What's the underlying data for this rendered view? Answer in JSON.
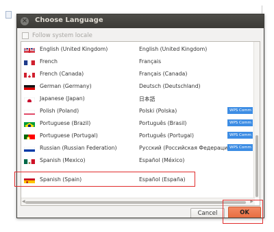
{
  "dialog": {
    "title": "Choose Language",
    "close_glyph": "×",
    "follow_label": "Follow system locale",
    "follow_checked": false
  },
  "languages": [
    {
      "english": "English (United Kingdom)",
      "native": "English (United Kingdom)",
      "flag": "uk-flag-icon",
      "badge": ""
    },
    {
      "english": "French",
      "native": "Français",
      "flag": "france-flag-icon",
      "badge": ""
    },
    {
      "english": "French (Canada)",
      "native": "Français (Canada)",
      "flag": "canada-flag-icon",
      "badge": ""
    },
    {
      "english": "German (Germany)",
      "native": "Deutsch (Deutschland)",
      "flag": "germany-flag-icon",
      "badge": ""
    },
    {
      "english": "Japanese (Japan)",
      "native": "日本語",
      "flag": "japan-flag-icon",
      "badge": ""
    },
    {
      "english": "Polish (Poland)",
      "native": "Polski (Polska)",
      "flag": "poland-flag-icon",
      "badge": "WPS Comm"
    },
    {
      "english": "Portuguese (Brazil)",
      "native": "Português (Brasil)",
      "flag": "brazil-flag-icon",
      "badge": "WPS Comm"
    },
    {
      "english": "Portuguese (Portugal)",
      "native": "Português (Portugal)",
      "flag": "portugal-flag-icon",
      "badge": "WPS Comm"
    },
    {
      "english": "Russian (Russian Federation)",
      "native": "Русский (Российская Федерация)",
      "flag": "russia-flag-icon",
      "badge": "WPS Comm"
    },
    {
      "english": "Spanish (Mexico)",
      "native": "Español (México)",
      "flag": "mexico-flag-icon",
      "badge": ""
    },
    {
      "english": "Spanish (Spain)",
      "native": "Español (España)",
      "flag": "spain-flag-icon",
      "badge": ""
    }
  ],
  "buttons": {
    "cancel": "Cancel",
    "ok": "OK"
  },
  "colors": {
    "titlebar": "#3c3b37",
    "ok_button": "#e66c3f",
    "badge": "#3d8de4",
    "highlight": "#e02b2b"
  }
}
